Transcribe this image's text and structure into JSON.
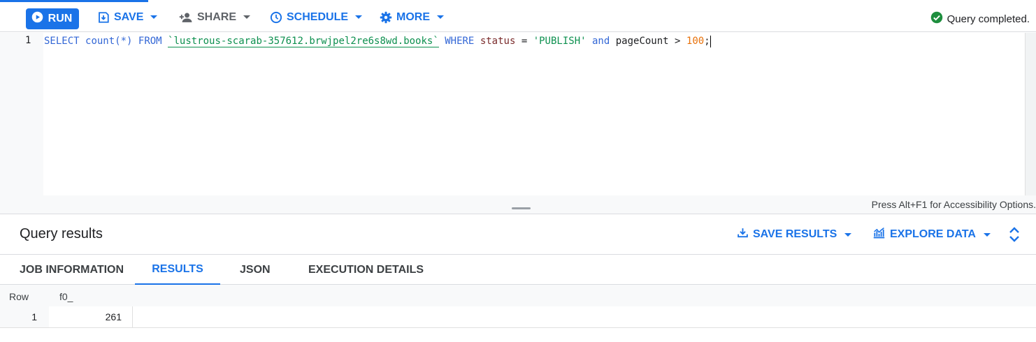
{
  "toolbar": {
    "run_label": "RUN",
    "save_label": "SAVE",
    "share_label": "SHARE",
    "schedule_label": "SCHEDULE",
    "more_label": "MORE",
    "status_text": "Query completed."
  },
  "editor": {
    "line_number": "1",
    "tokens": {
      "select": "SELECT",
      "count": "count(*)",
      "from": "FROM",
      "table": "`lustrous-scarab-357612.brwjpel2re6s8wd.books`",
      "where": "WHERE",
      "status_col": "status",
      "eq": "=",
      "status_val": "'PUBLISH'",
      "and": "and",
      "page_col": "pageCount",
      "gt": ">",
      "page_val": "100",
      "semicolon": ";"
    },
    "accessibility_hint": "Press Alt+F1 for Accessibility Options."
  },
  "results": {
    "title": "Query results",
    "save_results_label": "SAVE RESULTS",
    "explore_data_label": "EXPLORE DATA",
    "tabs": [
      {
        "label": "JOB INFORMATION"
      },
      {
        "label": "RESULTS"
      },
      {
        "label": "JSON"
      },
      {
        "label": "EXECUTION DETAILS"
      }
    ],
    "active_tab": "RESULTS",
    "columns": [
      "Row",
      "f0_"
    ],
    "rows": [
      {
        "row": "1",
        "f0_": "261"
      }
    ]
  },
  "colors": {
    "accent": "#1a73e8",
    "success": "#1e8e3e"
  },
  "icons": {
    "run": "play-circle-icon",
    "save": "save-icon",
    "share": "person-add-icon",
    "schedule": "clock-icon",
    "more": "gear-icon",
    "status": "check-circle-icon",
    "save_results": "download-icon",
    "explore_data": "chart-icon",
    "expand": "unfold-icon"
  }
}
